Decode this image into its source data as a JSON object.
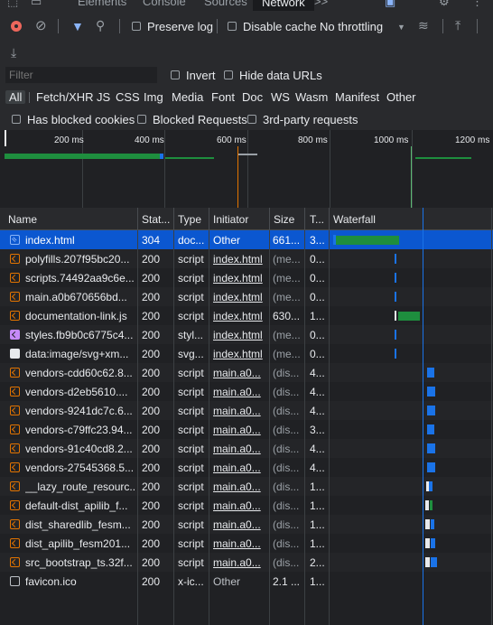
{
  "tabs": {
    "elements": "Elements",
    "console": "Console",
    "sources": "Sources",
    "network": "Network",
    "more": ">>"
  },
  "toolbar": {
    "preserve_log": "Preserve log",
    "disable_cache": "Disable cache",
    "throttling": "No throttling"
  },
  "filter": {
    "placeholder": "Filter",
    "invert": "Invert",
    "hide_data_urls": "Hide data URLs"
  },
  "types": [
    "All",
    "Fetch/XHR",
    "JS",
    "CSS",
    "Img",
    "Media",
    "Font",
    "Doc",
    "WS",
    "Wasm",
    "Manifest",
    "Other"
  ],
  "options": {
    "blocked_cookies": "Has blocked cookies",
    "blocked_requests": "Blocked Requests",
    "third_party": "3rd-party requests"
  },
  "overview_ticks": [
    "200 ms",
    "400 ms",
    "600 ms",
    "800 ms",
    "1000 ms",
    "1200 ms"
  ],
  "columns": {
    "name": "Name",
    "status": "Stat...",
    "type": "Type",
    "initiator": "Initiator",
    "size": "Size",
    "time": "T...",
    "waterfall": "Waterfall"
  },
  "requests": [
    {
      "name": "index.html",
      "status": "304",
      "type": "doc...",
      "initiator": "Other",
      "size": "661...",
      "time": "3...",
      "icon": "document-icon"
    },
    {
      "name": "polyfills.207f95bc20...",
      "status": "200",
      "type": "script",
      "initiator": "index.html",
      "size": "(me...",
      "time": "0...",
      "icon": "script-icon"
    },
    {
      "name": "scripts.74492aa9c6e...",
      "status": "200",
      "type": "script",
      "initiator": "index.html",
      "size": "(me...",
      "time": "0...",
      "icon": "script-icon"
    },
    {
      "name": "main.a0b670656bd...",
      "status": "200",
      "type": "script",
      "initiator": "index.html",
      "size": "(me...",
      "time": "0...",
      "icon": "script-icon"
    },
    {
      "name": "documentation-link.js",
      "status": "200",
      "type": "script",
      "initiator": "index.html",
      "size": "630...",
      "time": "1...",
      "icon": "script-icon"
    },
    {
      "name": "styles.fb9b0c6775c4...",
      "status": "200",
      "type": "styl...",
      "initiator": "index.html",
      "size": "(me...",
      "time": "0...",
      "icon": "stylesheet-icon"
    },
    {
      "name": "data:image/svg+xm...",
      "status": "200",
      "type": "svg...",
      "initiator": "index.html",
      "size": "(me...",
      "time": "0...",
      "icon": "image-icon"
    },
    {
      "name": "vendors-cdd60c62.8...",
      "status": "200",
      "type": "script",
      "initiator": "main.a0...",
      "size": "(dis...",
      "time": "4...",
      "icon": "script-icon"
    },
    {
      "name": "vendors-d2eb5610....",
      "status": "200",
      "type": "script",
      "initiator": "main.a0...",
      "size": "(dis...",
      "time": "4...",
      "icon": "script-icon"
    },
    {
      "name": "vendors-9241dc7c.6...",
      "status": "200",
      "type": "script",
      "initiator": "main.a0...",
      "size": "(dis...",
      "time": "4...",
      "icon": "script-icon"
    },
    {
      "name": "vendors-c79ffc23.94...",
      "status": "200",
      "type": "script",
      "initiator": "main.a0...",
      "size": "(dis...",
      "time": "3...",
      "icon": "script-icon"
    },
    {
      "name": "vendors-91c40cd8.2...",
      "status": "200",
      "type": "script",
      "initiator": "main.a0...",
      "size": "(dis...",
      "time": "4...",
      "icon": "script-icon"
    },
    {
      "name": "vendors-27545368.5...",
      "status": "200",
      "type": "script",
      "initiator": "main.a0...",
      "size": "(dis...",
      "time": "4...",
      "icon": "script-icon"
    },
    {
      "name": "__lazy_route_resourc...",
      "status": "200",
      "type": "script",
      "initiator": "main.a0...",
      "size": "(dis...",
      "time": "1...",
      "icon": "script-icon"
    },
    {
      "name": "default-dist_apilib_f...",
      "status": "200",
      "type": "script",
      "initiator": "main.a0...",
      "size": "(dis...",
      "time": "1...",
      "icon": "script-icon"
    },
    {
      "name": "dist_sharedlib_fesm...",
      "status": "200",
      "type": "script",
      "initiator": "main.a0...",
      "size": "(dis...",
      "time": "1...",
      "icon": "script-icon"
    },
    {
      "name": "dist_apilib_fesm201...",
      "status": "200",
      "type": "script",
      "initiator": "main.a0...",
      "size": "(dis...",
      "time": "1...",
      "icon": "script-icon"
    },
    {
      "name": "src_bootstrap_ts.32f...",
      "status": "200",
      "type": "script",
      "initiator": "main.a0...",
      "size": "(dis...",
      "time": "2...",
      "icon": "script-icon"
    },
    {
      "name": "favicon.ico",
      "status": "200",
      "type": "x-ic...",
      "initiator": "Other",
      "size": "2.1 ...",
      "time": "1...",
      "icon": "other-icon"
    }
  ]
}
